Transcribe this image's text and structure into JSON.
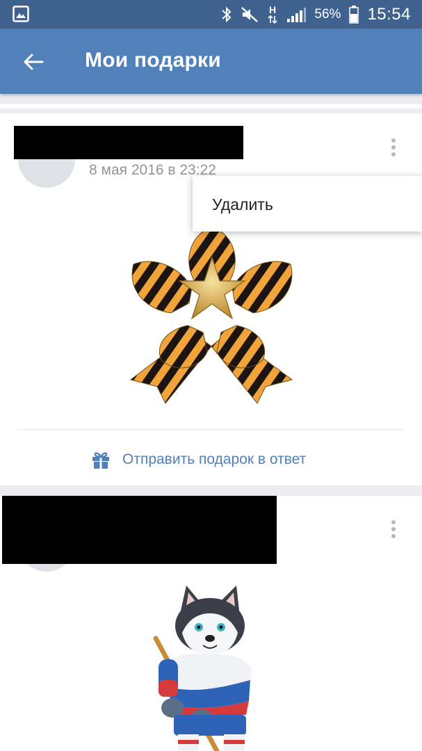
{
  "status_bar": {
    "battery": "56%",
    "time": "15:54",
    "network_label": "H",
    "icons": [
      "gallery-icon",
      "bluetooth-icon",
      "mute-icon",
      "data-arrows-icon",
      "signal-icon",
      "battery-icon"
    ]
  },
  "header": {
    "title": "Мои подарки",
    "back_icon": "arrow-left-icon",
    "color": "#5181b8"
  },
  "gifts": [
    {
      "date": "8 мая 2016 в 23:22",
      "sender_redacted": true,
      "image": "st-george-ribbon-star",
      "reply_label": "Отправить подарок в ответ",
      "reply_icon": "gift-icon"
    },
    {
      "date": "",
      "sender_redacted": true,
      "image": "husky-hockey-player"
    }
  ],
  "context_menu": {
    "items": [
      "Удалить"
    ]
  },
  "colors": {
    "status_bar": "#40628e",
    "accent": "#5181b8",
    "background": "#ebedf0",
    "muted_text": "#939393"
  }
}
